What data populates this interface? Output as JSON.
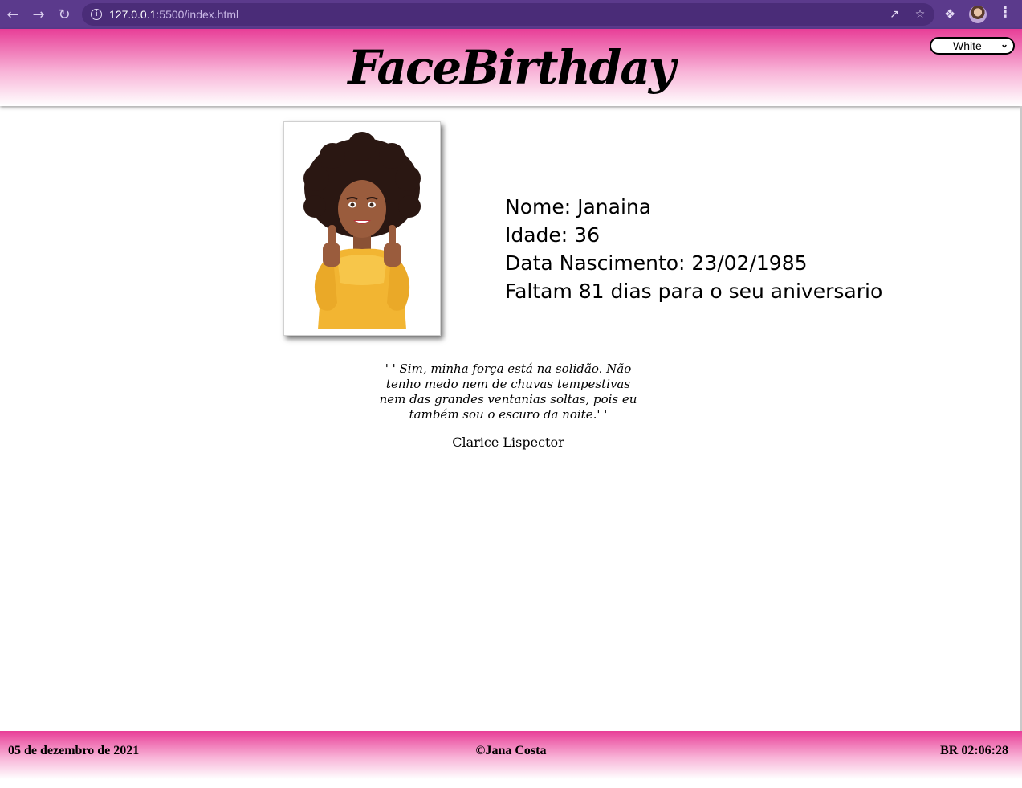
{
  "browser": {
    "url_host": "127.0.0.1",
    "url_rest": ":5500/index.html",
    "back_icon": "arrow-left-icon",
    "forward_icon": "arrow-right-icon",
    "reload_icon": "reload-icon"
  },
  "header": {
    "logo": "FaceBirthday",
    "theme_select": {
      "value": "White",
      "options": [
        "White"
      ]
    }
  },
  "profile": {
    "name_line": "Nome: Janaina",
    "age_line": "Idade: 36",
    "birth_line": "Data Nascimento: 23/02/1985",
    "countdown_line": "Faltam 81 dias para o seu aniversario"
  },
  "quote": {
    "text": "' ' Sim, minha força está na solidão. Não tenho medo nem de chuvas tempestivas nem das grandes ventanias soltas, pois eu também sou o escuro da noite.' '",
    "author": "Clarice Lispector"
  },
  "footer": {
    "date": "05 de dezembro de 2021",
    "copyright": "©Jana Costa",
    "clock": "BR 02:06:28"
  },
  "colors": {
    "chrome": "#5b3a8c",
    "accent_pink": "#e83e97"
  }
}
